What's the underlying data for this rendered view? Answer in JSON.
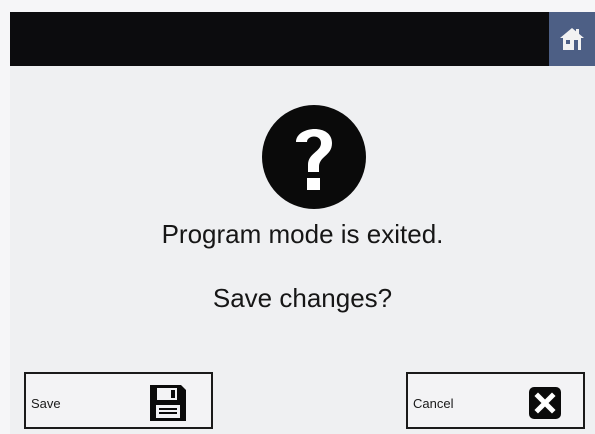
{
  "header": {
    "home_icon": "home-icon"
  },
  "dialog": {
    "icon": "question-icon",
    "message_line1": "Program mode is exited.",
    "message_line2": "Save changes?"
  },
  "buttons": {
    "save_label": "Save",
    "save_icon": "floppy-disk-icon",
    "cancel_label": "Cancel",
    "cancel_icon": "close-icon"
  },
  "colors": {
    "top_bar": "#0c0c0e",
    "home_button": "#4d5f85",
    "background": "#eff0f2",
    "text": "#161616"
  }
}
